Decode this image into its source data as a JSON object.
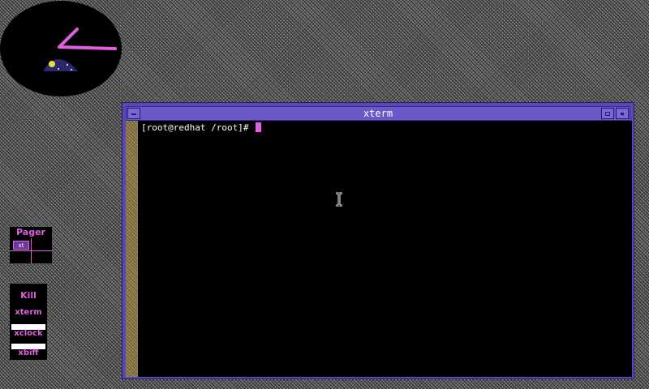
{
  "desktop": {
    "clock": {
      "icon": "xclock-analog-icon"
    }
  },
  "pager": {
    "title": "Pager",
    "mini_window_label": "xt"
  },
  "icon_panel": {
    "kill_label": "Kill",
    "items": [
      {
        "label": "xterm"
      },
      {
        "label": "xclock"
      },
      {
        "label": "xbiff"
      }
    ]
  },
  "xterm": {
    "title": "xterm",
    "prompt": "[root@redhat /root]#",
    "colors": {
      "title_bar": "#6b58c8",
      "frame": "#5b48b8",
      "accent": "#e060e0",
      "background": "#000000"
    }
  }
}
